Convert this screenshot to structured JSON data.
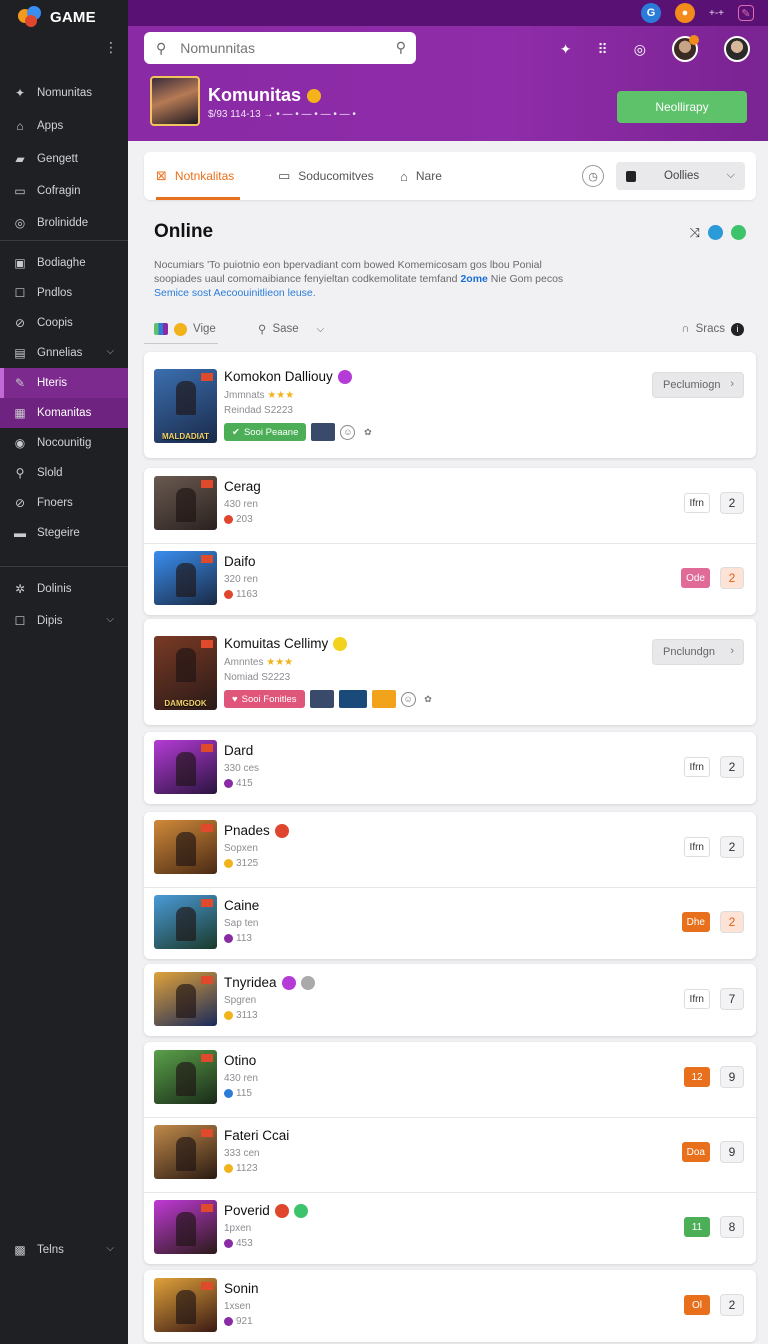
{
  "app": {
    "logo_text": "GAME"
  },
  "sidebar": {
    "items": [
      {
        "label": "Nomunitas",
        "icon": "feather-icon"
      },
      {
        "label": "Apps",
        "icon": "home-icon"
      },
      {
        "label": "Gengett",
        "icon": "controller-icon"
      },
      {
        "label": "Cofragin",
        "icon": "monitor-icon"
      },
      {
        "label": "Brolinidde",
        "icon": "compass-icon"
      },
      {
        "label": "Bodiaghe",
        "icon": "image-icon"
      },
      {
        "label": "Pndlos",
        "icon": "square-icon"
      },
      {
        "label": "Coopis",
        "icon": "link-icon"
      },
      {
        "label": "Gnnelias",
        "icon": "grid-icon"
      },
      {
        "label": "Hteris",
        "icon": "pen-icon"
      },
      {
        "label": "Komanitas",
        "icon": "group-icon"
      },
      {
        "label": "Nocounitig",
        "icon": "globe-icon"
      },
      {
        "label": "Slold",
        "icon": "search-icon"
      },
      {
        "label": "Fnoers",
        "icon": "tag-icon"
      },
      {
        "label": "Stegeire",
        "icon": "layers-icon"
      },
      {
        "label": "Dolinis",
        "icon": "gear-icon"
      },
      {
        "label": "Dipis",
        "icon": "box-icon"
      },
      {
        "label": "Telns",
        "icon": "briefcase-icon"
      }
    ]
  },
  "topbar": {
    "clock": "+-+"
  },
  "header": {
    "search_placeholder": "Nomunnitas",
    "community_name": "Komunitas",
    "community_meta": "$/93 114-13 → • — • — • — • — •",
    "join_label": "Neollirapy"
  },
  "tabs": [
    {
      "label": "Notnkalitas",
      "icon": "controller-icon"
    },
    {
      "label": "Soducomitves",
      "icon": "window-icon"
    },
    {
      "label": "Nare",
      "icon": "home-icon"
    }
  ],
  "online_select": {
    "value": "Oollies"
  },
  "section": {
    "title": "Online",
    "desc_1": "Nocumiars 'To puiotnio eon bpervadiant com bowed Komemicosam gos lbou Ponial soopiades uaul comomaibiance fenyieltan codkemolitate temfand ",
    "desc_hl2": "2ome",
    "desc_2": " Nie Gom pecos ",
    "desc_hl1": "Semice sost Aecoouinitlieon leuse."
  },
  "filters": {
    "vige": "Vige",
    "sase": "Sase",
    "sracs": "Sracs"
  },
  "featured": [
    {
      "title": "Komokon Dalliouy",
      "sub": "Jmmnats",
      "meta": "Reindad S2223",
      "tag": "Sooi Peaane",
      "button": "Peclumiogn",
      "thumb_text": "MALDADIAT",
      "colors": [
        "#3b6fb0",
        "#1a2a4a"
      ],
      "tag_color": "#4caf58"
    },
    {
      "title": "Komuitas Cellimy",
      "sub": "Amnntes",
      "meta": "Nomiad S2223",
      "tag": "Sooi Fonitles",
      "button": "Pnclundgn",
      "thumb_text": "DAMGDOK",
      "colors": [
        "#7a3a25",
        "#2a1a18"
      ],
      "tag_color": "#e0557a"
    }
  ],
  "rows": [
    {
      "title": "Cerag",
      "sub": "430 ren",
      "meta": "203",
      "label": "Ifrn",
      "count": "2",
      "c1": "#6a5a50",
      "c2": "#2a2220",
      "mc": "#e0462e",
      "lbg": "#fff",
      "lfg": "#333",
      "cbg": "#f3f3f5",
      "cfg": "#333"
    },
    {
      "title": "Daifo",
      "sub": "320 ren",
      "meta": "1163",
      "label": "Ode",
      "count": "2",
      "c1": "#3a8ef0",
      "c2": "#1a2a44",
      "mc": "#e0462e",
      "lbg": "#e06a98",
      "lfg": "#fff",
      "cbg": "#fde3d6",
      "cfg": "#e0601c"
    },
    {
      "title": "Dard",
      "sub": "330 ces",
      "meta": "415",
      "label": "Ifrn",
      "count": "2",
      "c1": "#b53bd6",
      "c2": "#2a1440",
      "mc": "#8a2aa5",
      "lbg": "#fff",
      "lfg": "#333",
      "cbg": "#f3f3f5",
      "cfg": "#333"
    },
    {
      "title": "Pnades",
      "sub": "Sopxen",
      "meta": "3125",
      "label": "Ifrn",
      "count": "2",
      "c1": "#d08a3a",
      "c2": "#4a2a14",
      "mc": "#f2b21b",
      "lbg": "#fff",
      "lfg": "#333",
      "cbg": "#f3f3f5",
      "cfg": "#333"
    },
    {
      "title": "Caine",
      "sub": "Sap ten",
      "meta": "113",
      "label": "Dhe",
      "count": "2",
      "c1": "#4a9ad8",
      "c2": "#1a3a2a",
      "mc": "#8a2aa5",
      "lbg": "#e8701c",
      "lfg": "#fff",
      "cbg": "#fde3d6",
      "cfg": "#e0601c"
    },
    {
      "title": "Tnyridea",
      "sub": "Spgren",
      "meta": "3113",
      "label": "Ifrn",
      "count": "7",
      "c1": "#e0a23a",
      "c2": "#1a2a5a",
      "mc": "#f2b21b",
      "lbg": "#fff",
      "lfg": "#333",
      "cbg": "#f3f3f5",
      "cfg": "#333"
    },
    {
      "title": "Otino",
      "sub": "430 ren",
      "meta": "115",
      "label": "12",
      "count": "9",
      "c1": "#5aa04a",
      "c2": "#1a2a18",
      "mc": "#2a7cd8",
      "lbg": "#e8701c",
      "lfg": "#fff",
      "cbg": "#f3f3f5",
      "cfg": "#333"
    },
    {
      "title": "Fateri Ccai",
      "sub": "333 cen",
      "meta": "1123",
      "label": "Doa",
      "count": "9",
      "c1": "#c08a4a",
      "c2": "#2a1a12",
      "mc": "#f2b21b",
      "lbg": "#e8701c",
      "lfg": "#fff",
      "cbg": "#f3f3f5",
      "cfg": "#333"
    },
    {
      "title": "Poverid",
      "sub": "1pxen",
      "meta": "453",
      "label": "11",
      "count": "8",
      "c1": "#c03ad6",
      "c2": "#2a1a18",
      "mc": "#8a2aa5",
      "lbg": "#4caf58",
      "lfg": "#fff",
      "cbg": "#f3f3f5",
      "cfg": "#333"
    },
    {
      "title": "Sonin",
      "sub": "1xsen",
      "meta": "921",
      "label": "Ol",
      "count": "2",
      "c1": "#e0a23a",
      "c2": "#3a1a14",
      "mc": "#8a2aa5",
      "lbg": "#e8701c",
      "lfg": "#fff",
      "cbg": "#f3f3f5",
      "cfg": "#333"
    }
  ],
  "colors": {
    "accent": "#e8701c",
    "brand": "#8a2aa5",
    "success": "#5ec26a"
  }
}
